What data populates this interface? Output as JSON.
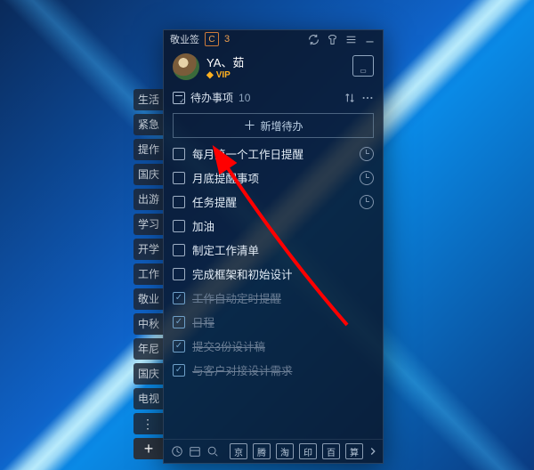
{
  "titlebar": {
    "app_name": "敬业签",
    "badge": "C",
    "badge_count": "3"
  },
  "profile": {
    "name": "YA、茹",
    "vip": "VIP"
  },
  "section": {
    "title": "待办事项",
    "count": "10"
  },
  "add_button": {
    "label": "新增待办"
  },
  "sidebar": {
    "items": [
      {
        "label": "生活"
      },
      {
        "label": "紧急"
      },
      {
        "label": "提作"
      },
      {
        "label": "国庆"
      },
      {
        "label": "出游"
      },
      {
        "label": "学习"
      },
      {
        "label": "开学"
      },
      {
        "label": "工作"
      },
      {
        "label": "敬业"
      },
      {
        "label": "中秋"
      },
      {
        "label": "年尼"
      },
      {
        "label": "国庆"
      },
      {
        "label": "电视"
      }
    ]
  },
  "todo": {
    "items": [
      {
        "label": "每月第一个工作日提醒",
        "done": false,
        "clock": true
      },
      {
        "label": "月底提醒事项",
        "done": false,
        "clock": true
      },
      {
        "label": "任务提醒",
        "done": false,
        "clock": true
      },
      {
        "label": "加油",
        "done": false,
        "clock": false
      },
      {
        "label": "制定工作清单",
        "done": false,
        "clock": false
      },
      {
        "label": "完成框架和初始设计",
        "done": false,
        "clock": false
      },
      {
        "label": "工作自动定时提醒",
        "done": true,
        "clock": false
      },
      {
        "label": "日程",
        "done": true,
        "clock": false
      },
      {
        "label": "提交3份设计稿",
        "done": true,
        "clock": false
      },
      {
        "label": "与客户对接设计需求",
        "done": true,
        "clock": false
      }
    ]
  },
  "footer": {
    "chips": [
      "京",
      "腾",
      "淘",
      "印",
      "百",
      "算"
    ]
  }
}
